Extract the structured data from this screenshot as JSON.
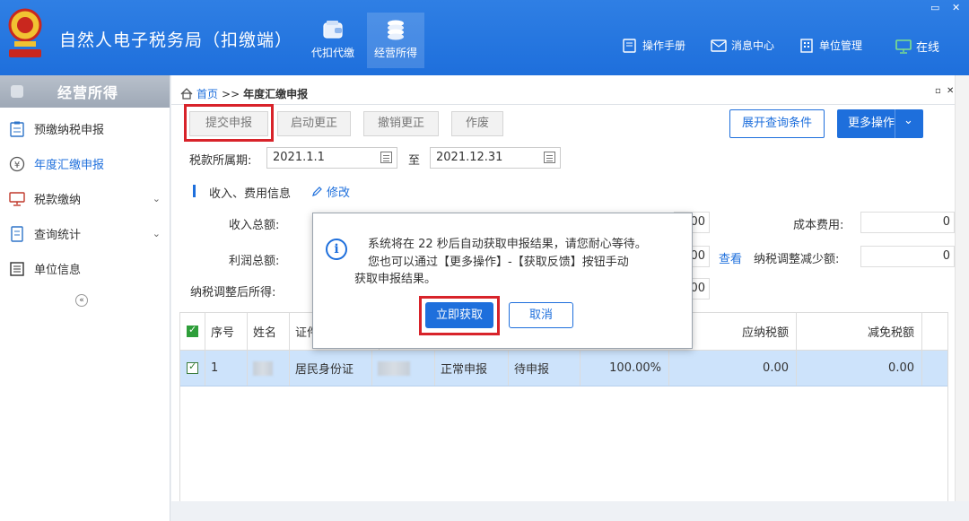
{
  "app": {
    "title": "自然人电子税务局（扣缴端）"
  },
  "nav": [
    {
      "label": "代扣代缴",
      "icon": "wallet-icon"
    },
    {
      "label": "经营所得",
      "icon": "coins-icon"
    }
  ],
  "header_links": [
    {
      "label": "操作手册",
      "icon": "manual-icon"
    },
    {
      "label": "消息中心",
      "icon": "mail-icon"
    },
    {
      "label": "单位管理",
      "icon": "building-icon"
    },
    {
      "label": "在线",
      "icon": "monitor-icon"
    }
  ],
  "window_controls": {
    "restore": "▭",
    "close": "✕"
  },
  "sidebar": {
    "title": "经营所得",
    "items": [
      {
        "label": "预缴纳税申报",
        "icon": "clipboard-icon"
      },
      {
        "label": "年度汇缴申报",
        "icon": "yen-icon",
        "active": true
      },
      {
        "label": "税款缴纳",
        "icon": "monitor-icon",
        "expandable": true
      },
      {
        "label": "查询统计",
        "icon": "doc-icon",
        "expandable": true
      },
      {
        "label": "单位信息",
        "icon": "list-icon"
      }
    ],
    "collapse": "«"
  },
  "breadcrumb": {
    "home": "首页",
    "separator": ">>",
    "current": "年度汇缴申报"
  },
  "panel_controls": {
    "restore": "▫",
    "close": "✕"
  },
  "toolbar": {
    "submit": "提交申报",
    "start_correction": "启动更正",
    "cancel_correction": "撤销更正",
    "void": "作废",
    "expand_query": "展开查询条件",
    "more_actions": "更多操作",
    "more_caret": "⌄"
  },
  "period": {
    "label": "税款所属期:",
    "start": "2021.1.1",
    "to": "至",
    "end": "2021.12.31"
  },
  "section": {
    "title": "收入、费用信息",
    "edit": "修改"
  },
  "fields": {
    "income_total_label": "收入总额:",
    "income_total_value": "00",
    "cost_label": "成本费用:",
    "cost_value": "0",
    "profit_label": "利润总额:",
    "profit_value": "00",
    "view_link": "查看",
    "tax_adj_reduce_label": "纳税调整减少额:",
    "tax_adj_reduce_value": "0",
    "after_adj_label": "纳税调整后所得:",
    "after_adj_value": "00"
  },
  "table": {
    "columns": [
      "序号",
      "姓名",
      "证件",
      "应纳税额",
      "减免税额"
    ],
    "rows": [
      {
        "index": "1",
        "name": "",
        "id_type": "居民身份证",
        "id_no": "",
        "report_type": "正常申报",
        "status": "待申报",
        "ratio": "100.00%",
        "tax_due": "0.00",
        "tax_relief": "0.00"
      }
    ]
  },
  "dialog": {
    "line1": "系统将在 22 秒后自动获取申报结果，请您耐心等待。",
    "line2": "您也可以通过【更多操作】-【获取反馈】按钮手动",
    "line3": "获取申报结果。",
    "confirm": "立即获取",
    "cancel": "取消",
    "info_glyph": "i"
  },
  "colors": {
    "brand": "#1e6fdc",
    "highlight": "#d8232a",
    "row_selected": "#cde3fb"
  }
}
